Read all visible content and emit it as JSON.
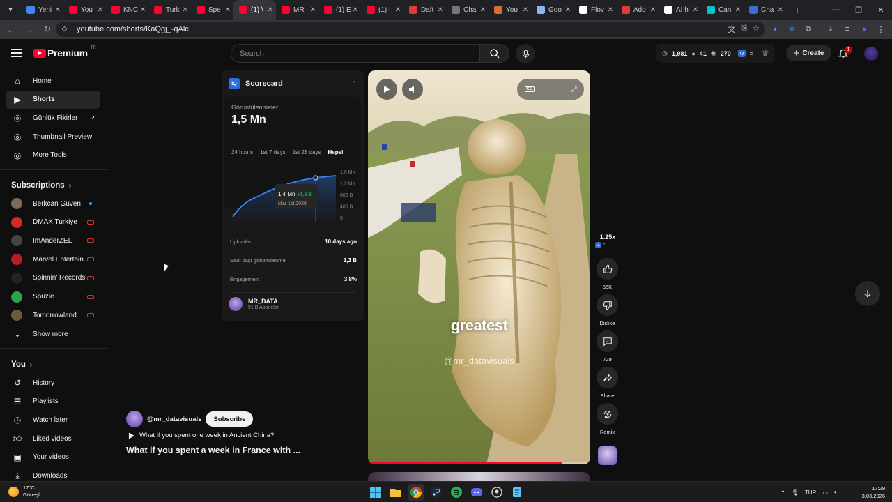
{
  "browser": {
    "tabs": [
      {
        "label": "Yeni",
        "color": "#4285f4"
      },
      {
        "label": "You",
        "color": "#ff0033"
      },
      {
        "label": "KNC",
        "color": "#ff0033"
      },
      {
        "label": "Turk",
        "color": "#ff0033"
      },
      {
        "label": "Spe",
        "color": "#ff0033"
      },
      {
        "label": "(1) \\",
        "color": "#ff0033",
        "active": true
      },
      {
        "label": "MR",
        "color": "#ff0033"
      },
      {
        "label": "(1) E",
        "color": "#ff0033"
      },
      {
        "label": "(1) I",
        "color": "#ff0033"
      },
      {
        "label": "Daft",
        "color": "#e53935"
      },
      {
        "label": "Cha",
        "color": "#777777"
      },
      {
        "label": "You",
        "color": "#d96c3a"
      },
      {
        "label": "Goo",
        "color": "#8ab4f8"
      },
      {
        "label": "Flov",
        "color": "#ffffff"
      },
      {
        "label": "Ado",
        "color": "#e53935"
      },
      {
        "label": "AI h",
        "color": "#ffffff"
      },
      {
        "label": "Can",
        "color": "#00c4cc"
      },
      {
        "label": "Cha",
        "color": "#3b6fd6"
      }
    ],
    "url": "youtube.com/shorts/KaQgj_-qAlc"
  },
  "header": {
    "logo_text": "Premium",
    "logo_country": "TR",
    "search_placeholder": "Search",
    "stats": {
      "a": "1,981",
      "b": "41",
      "c": "270"
    },
    "create_label": "Create",
    "notification_count": "1"
  },
  "sidebar": {
    "main": [
      {
        "label": "Home",
        "icon": "home-icon"
      },
      {
        "label": "Shorts",
        "icon": "shorts-icon",
        "active": true
      },
      {
        "label": "Günlük Fikirler",
        "icon": "ext-icon"
      },
      {
        "label": "Thumbnail Preview",
        "icon": "ext-icon"
      },
      {
        "label": "More Tools",
        "icon": "ext-icon"
      }
    ],
    "subscriptions_title": "Subscriptions",
    "subscriptions": [
      {
        "label": "Berkcan Güven",
        "color": "#7a6a5a",
        "status": "dot"
      },
      {
        "label": "DMAX Turkiye",
        "color": "#d62828",
        "status": "live"
      },
      {
        "label": "ImAnderZEL",
        "color": "#444444",
        "status": "live"
      },
      {
        "label": "Marvel Entertain...",
        "color": "#b81d24",
        "status": "live"
      },
      {
        "label": "Spinnin' Records",
        "color": "#222222",
        "status": "live"
      },
      {
        "label": "Spuzie",
        "color": "#2aa24a",
        "status": "live"
      },
      {
        "label": "Tomorrowland",
        "color": "#6b5a3a",
        "status": "live"
      }
    ],
    "show_more": "Show more",
    "you_title": "You",
    "you": [
      {
        "label": "History",
        "icon": "history-icon"
      },
      {
        "label": "Playlists",
        "icon": "playlists-icon"
      },
      {
        "label": "Watch later",
        "icon": "watch-later-icon"
      },
      {
        "label": "Liked videos",
        "icon": "like-icon"
      },
      {
        "label": "Your videos",
        "icon": "your-videos-icon"
      },
      {
        "label": "Downloads",
        "icon": "download-icon"
      }
    ]
  },
  "scorecard": {
    "title": "Scorecard",
    "badge": "iQ",
    "views_label": "Görüntülenmeler",
    "views_value": "1,5 Mn",
    "periods": [
      "24 hours",
      "1st 7 days",
      "1st 28 days",
      "Hepsi"
    ],
    "active_period": "Hepsi",
    "chart": {
      "y_ticks": [
        "1,6 Mn",
        "1,2 Mn",
        "800 B",
        "400 B",
        "0"
      ],
      "tooltip_value": "1,4 Mn",
      "tooltip_delta": "+1,3 B",
      "tooltip_date": "Mar 1st 2026"
    },
    "rows": [
      {
        "label": "Uploaded",
        "value": "10 days ago"
      },
      {
        "label": "Saat başı görüntülenme",
        "value": "1,3 B"
      },
      {
        "label": "Engagement",
        "value": "3.8%"
      }
    ],
    "channel_name": "MR_DATA",
    "channel_subs": "91 B Aboneler"
  },
  "video": {
    "caption": "greatest",
    "watermark": "@mr_datavisuals",
    "progress_fraction": 0.87
  },
  "actions": {
    "speed": "1.25x",
    "speed_badge": "iQ",
    "like_count": "55K",
    "dislike_label": "Dislike",
    "comment_count": "729",
    "share_label": "Share",
    "remix_label": "Remix"
  },
  "video_info": {
    "channel": "@mr_datavisuals",
    "subscribe_label": "Subscribe",
    "next_video": "What if you spent one week in Ancient China?",
    "title": "What if you spent a week in France with ..."
  },
  "taskbar": {
    "temperature": "17°C",
    "weather": "Güneşli",
    "lang": "TUR",
    "time": "17:29",
    "date": "3.03.2026"
  }
}
